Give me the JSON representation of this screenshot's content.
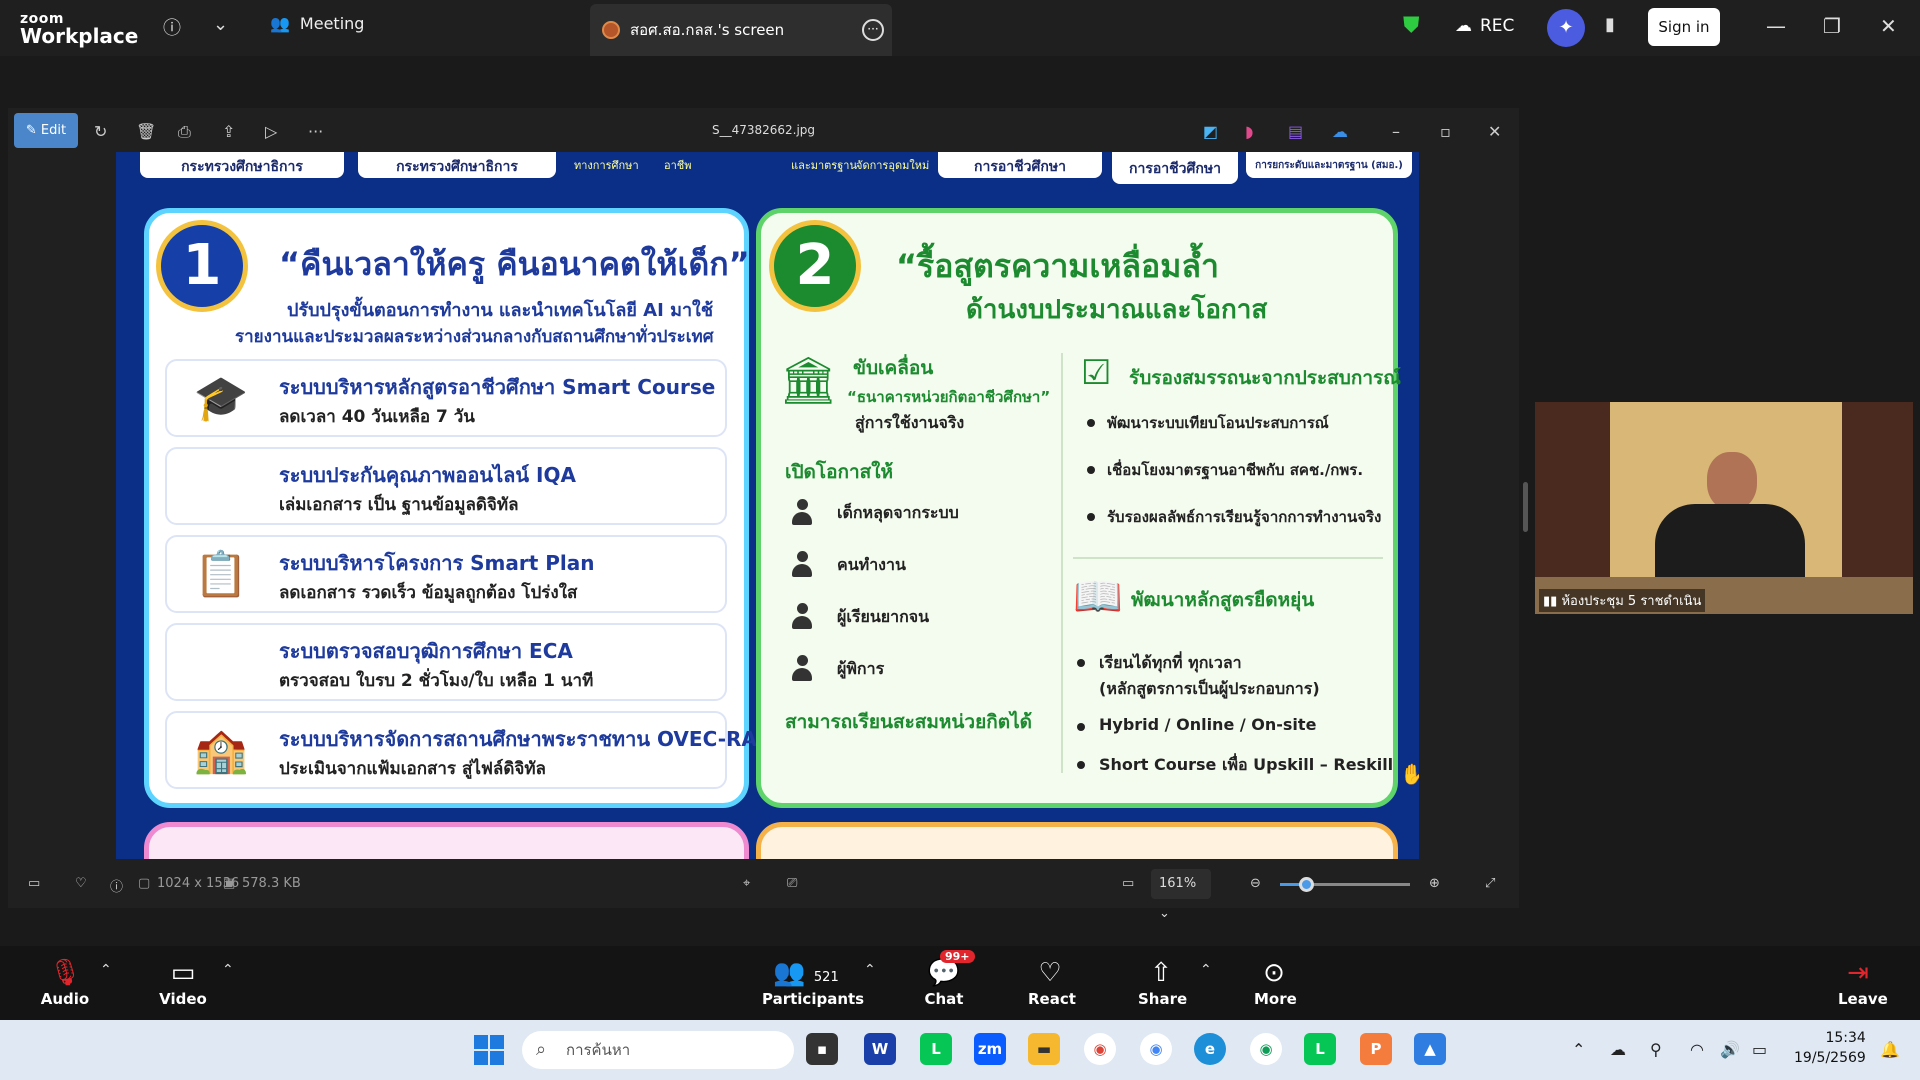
{
  "app": {
    "logo_line1": "zoom",
    "logo_line2": "Workplace"
  },
  "top_bar": {
    "meeting_label": "Meeting",
    "screen_tab_label": "สอศ.สอ.กลส.'s screen",
    "rec_label": "REC",
    "sign_in_label": "Sign in"
  },
  "viewer": {
    "edit_label": "Edit",
    "file_name": "S__47382662.jpg",
    "dimensions": "1024 x 1536",
    "file_size": "578.3 KB",
    "zoom_level": "161%",
    "zoom_slider_fraction": 0.2
  },
  "infographic": {
    "panel1": {
      "number": "1",
      "title": "“คืนเวลาให้ครู คืนอนาคตให้เด็ก”",
      "subtitle1": "ปรับปรุงขั้นตอนการทำงาน และนำเทคโนโลยี AI มาใช้",
      "subtitle2": "รายงานและประมวลผลระหว่างส่วนกลางกับสถานศึกษาทั่วประเทศ",
      "rows": [
        {
          "icon": "🎓",
          "title": "ระบบบริหารหลักสูตรอาชีวศึกษา Smart Course",
          "sub": "ลดเวลา 40 วันเหลือ 7 วัน"
        },
        {
          "icon": "🖥",
          "title": "ระบบประกันคุณภาพออนไลน์ IQA",
          "sub": "เล่มเอกสาร เป็น ฐานข้อมูลดิจิทัล"
        },
        {
          "icon": "📋",
          "title": "ระบบบริหารโครงการ Smart Plan",
          "sub": "ลดเอกสาร รวดเร็ว ข้อมูลถูกต้อง โปร่งใส"
        },
        {
          "icon": "🗒",
          "title": "ระบบตรวจสอบวุฒิการศึกษา ECA",
          "sub": "ตรวจสอบ ใบรบ 2 ชั่วโมง/ใบ เหลือ 1 นาที"
        },
        {
          "icon": "🏫",
          "title": "ระบบบริหารจัดการสถานศึกษาพระราชทาน OVEC-RA",
          "sub": "ประเมินจากแฟ้มเอกสาร สู่ไฟล์ดิจิทัล"
        }
      ]
    },
    "panel2": {
      "number": "2",
      "title1": "“รื้อสูตรความเหลื่อมล้ำ",
      "title2": "ด้านงบประมาณและโอกาส",
      "drive_label": "ขับเคลื่อน",
      "bank_label": "“ธนาคารหน่วยกิตอาชีวศึกษา”",
      "use_label": "สู่การใช้งานจริง",
      "open_label": "เปิดโอกาสให้",
      "groups": [
        "เด็กหลุดจากระบบ",
        "คนทำงาน",
        "ผู้เรียนยากจน",
        "ผู้พิการ"
      ],
      "accumulate_label": "สามารถเรียนสะสมหน่วยกิตได้",
      "cert_title": "รับรองสมรรถนะจากประสบการณ์",
      "cert_items": [
        "พัฒนาระบบเทียบโอนประสบการณ์",
        "เชื่อมโยงมาตรฐานอาชีพกับ สคช./กพร.",
        "รับรองผลลัพธ์การเรียนรู้จากการทำงานจริง"
      ],
      "flex_title": "พัฒนาหลักสูตรยืดหยุ่น",
      "flex_items": [
        "เรียนได้ทุกที่ ทุกเวลา",
        "(หลักสูตรการเป็นผู้ประกอบการ)",
        "Hybrid / Online / On-site",
        "Short Course เพื่อ Upskill – Reskill"
      ]
    },
    "top_pills": [
      "กระทรวงศึกษาธิการ",
      "กระทรวงศึกษาธิการ",
      "การอาชีวศึกษา",
      "การอาชีวศึกษา",
      "การยกระดับและมาตรฐาน (สมอ.)"
    ],
    "top_small": [
      "ทางการศึกษา",
      "อาชีพ",
      "และมาตรฐาน",
      "จัดการอุดมใหม่"
    ]
  },
  "video": {
    "name_label": "ห้องประชุม 5 ราชดำเนิน"
  },
  "controls": {
    "audio": "Audio",
    "video": "Video",
    "participants": "Participants",
    "participants_count": "521",
    "chat": "Chat",
    "chat_badge": "99+",
    "react": "React",
    "share": "Share",
    "more": "More",
    "leave": "Leave"
  },
  "taskbar": {
    "search_placeholder": "การค้นหา",
    "time": "15:34",
    "date": "19/5/2569"
  },
  "colors": {
    "accent": "#4a86c9",
    "panel1_border": "#5dd4ff",
    "panel2_border": "#5ed36a",
    "infographic_bg": "#0b2f87"
  }
}
